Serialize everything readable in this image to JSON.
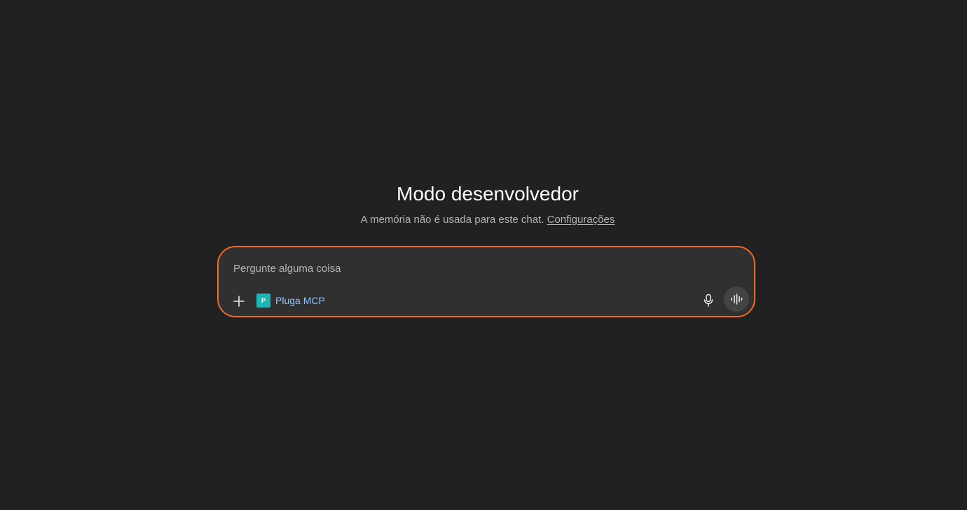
{
  "header": {
    "title": "Modo desenvolvedor",
    "memory_notice": "A memória não é usada para este chat.",
    "settings_link": "Configurações"
  },
  "composer": {
    "placeholder": "Pergunte alguma coisa",
    "value": "",
    "accent_color": "#f06a1e",
    "add_icon": "plus-icon",
    "connector": {
      "logo_letter": "P",
      "label": "Pluga MCP",
      "logo_color": "#1fb5b8"
    },
    "mic_icon": "microphone-icon",
    "voice_icon": "voice-waveform-icon"
  }
}
